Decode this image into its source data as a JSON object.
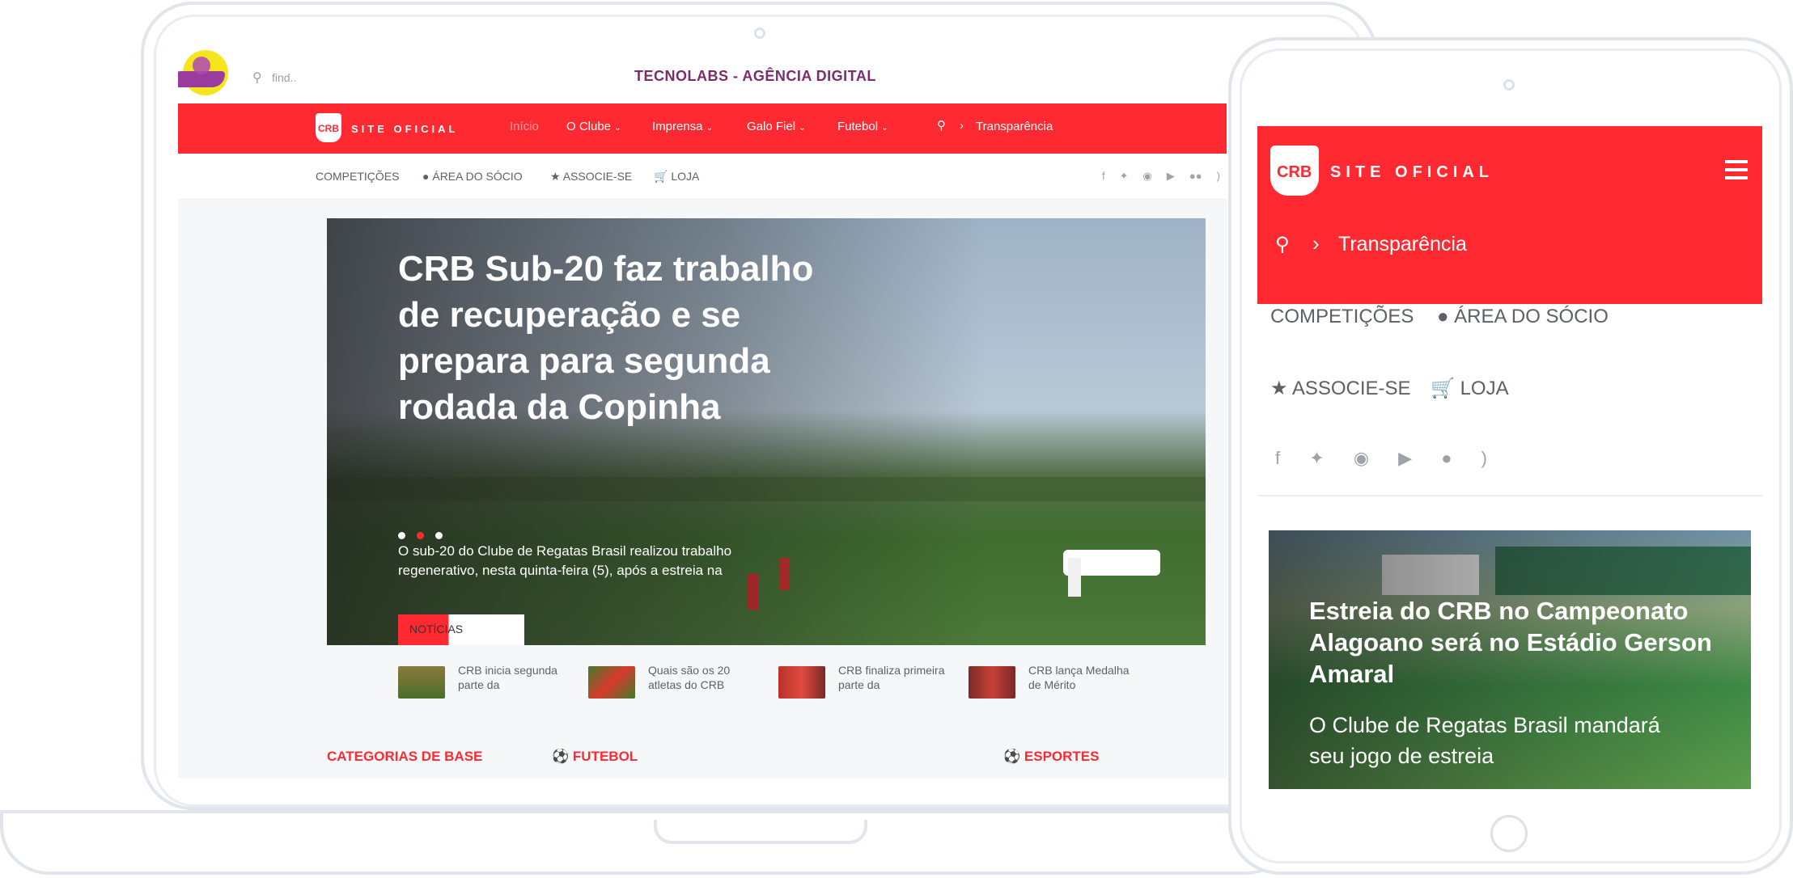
{
  "laptop": {
    "search": {
      "placeholder": "find.."
    },
    "agency_title": "TECNOLABS - AGÊNCIA DIGITAL",
    "brand": {
      "site_label": "SITE OFICIAL",
      "logo_text": "CRB"
    },
    "nav": {
      "items": [
        {
          "label": "Início",
          "has_dropdown": false
        },
        {
          "label": "O Clube",
          "has_dropdown": true
        },
        {
          "label": "Imprensa",
          "has_dropdown": true
        },
        {
          "label": "Galo Fiel",
          "has_dropdown": true
        },
        {
          "label": "Futebol",
          "has_dropdown": true
        }
      ],
      "transparency": "Transparência"
    },
    "subnav": {
      "items": [
        {
          "label": "COMPETIÇÕES",
          "icon": ""
        },
        {
          "label": "ÁREA DO SÓCIO",
          "icon": "user-icon"
        },
        {
          "label": "ASSOCIE-SE",
          "icon": "star-icon"
        },
        {
          "label": "LOJA",
          "icon": "cart-icon"
        }
      ],
      "social": [
        "facebook-icon",
        "twitter-icon",
        "instagram-icon",
        "youtube-icon",
        "flickr-icon",
        "rss-icon"
      ]
    },
    "hero": {
      "title": "CRB Sub-20 faz trabalho de recuperação e se prepara para segunda rodada da Copinha",
      "excerpt": "O sub-20 do Clube de Regatas Brasil realizou trabalho regenerativo, nesta quinta-feira (5), após a estreia na",
      "badge": "NOTÍCIAS",
      "slides": 3,
      "active_slide": 2
    },
    "thumbs": [
      {
        "text": "CRB inicia segunda parte da"
      },
      {
        "text": "Quais são os 20 atletas do CRB"
      },
      {
        "text": "CRB finaliza primeira parte da"
      },
      {
        "text": "CRB lança Medalha de Mérito"
      }
    ],
    "sections": [
      "CATEGORIAS DE BASE",
      "FUTEBOL",
      "ESPORTES"
    ],
    "colors": {
      "brand_red": "#ff2a31",
      "agency_purple": "#7b2d6b"
    }
  },
  "tablet": {
    "brand": {
      "site_label": "SITE OFICIAL",
      "logo_text": "CRB"
    },
    "transparency": "Transparência",
    "subnav": {
      "competicoes": "COMPETIÇÕES",
      "area_socio": "ÁREA DO SÓCIO",
      "associe": "ASSOCIE-SE",
      "loja": "LOJA"
    },
    "hero": {
      "title": "Estreia do CRB no Campeonato Alagoano será no Estádio Gerson Amaral",
      "excerpt": "O Clube de Regatas Brasil mandará seu jogo de estreia"
    }
  }
}
